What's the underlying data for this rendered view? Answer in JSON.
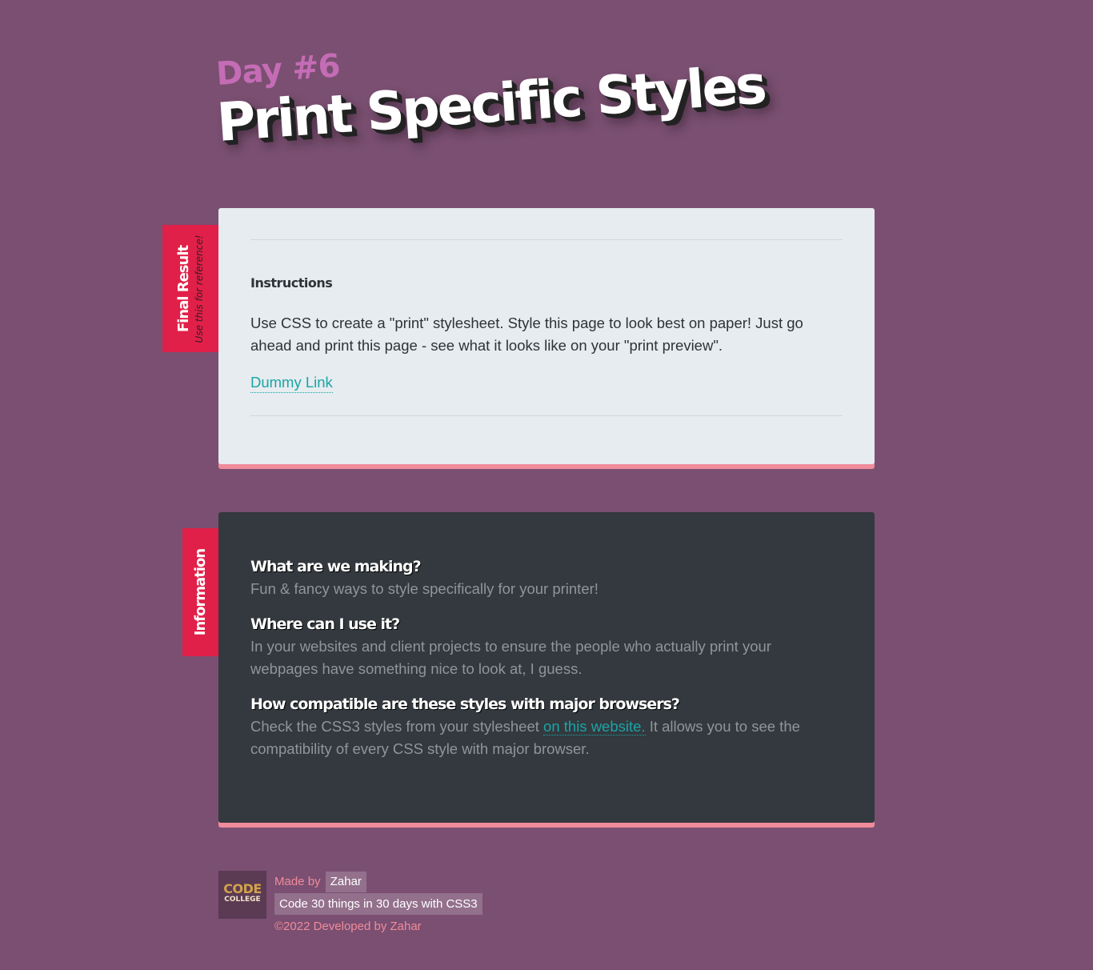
{
  "header": {
    "day": "Day #6",
    "title": "Print Specific Styles"
  },
  "final_result": {
    "tab_label": "Final Result",
    "tab_sublabel": "Use this for reference!",
    "heading": "Instructions",
    "text": "Use CSS to create a \"print\" stylesheet. Style this page to look best on paper! Just go ahead and print this page - see what it looks like on your \"print preview\".",
    "link_label": "Dummy Link"
  },
  "information": {
    "tab_label": "Information",
    "q1": "What are we making?",
    "a1": "Fun & fancy ways to style specifically for your printer!",
    "q2": "Where can I use it?",
    "a2": "In your websites and client projects to ensure the people who actually print your webpages have something nice to look at, I guess.",
    "q3": "How compatible are these styles with major browsers?",
    "a3_before": "Check the CSS3 styles from your stylesheet ",
    "a3_link": "on this website.",
    "a3_after": " It allows you to see the compatibility of every CSS style with major browser."
  },
  "footer": {
    "logo_top": "CODE",
    "logo_bottom": "COLLEGE",
    "made_by_label": "Made by",
    "author": "Zahar",
    "course": "Code 30 things in 30 days with CSS3",
    "copyright": "©2022 Developed by Zahar"
  },
  "colors": {
    "background": "#7a4f71",
    "accent_red": "#e02048",
    "accent_pink": "#f08b9b",
    "link": "#1aa5a6",
    "light_card": "#e6ecef",
    "dark_card": "#33393e"
  }
}
